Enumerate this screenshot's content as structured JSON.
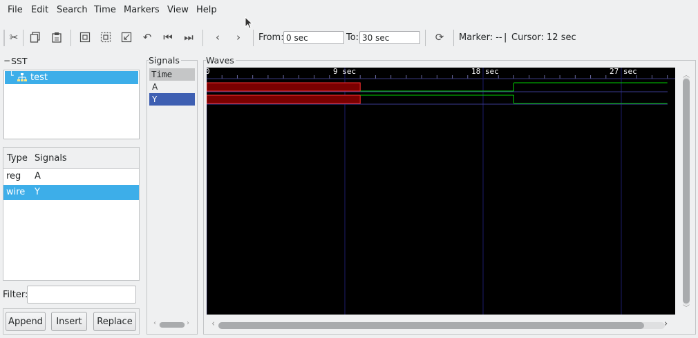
{
  "menu": [
    "File",
    "Edit",
    "Search",
    "Time",
    "Markers",
    "View",
    "Help"
  ],
  "toolbar": {
    "from_label": "From:",
    "from_value": "0 sec",
    "to_label": "To:",
    "to_value": "30 sec",
    "marker_text": "Marker: --",
    "separator": "|",
    "cursor_text": "Cursor: 12 sec"
  },
  "sst": {
    "title": "SST",
    "tree_item": "test",
    "table_headers": [
      "Type",
      "Signals"
    ],
    "rows": [
      {
        "type": "reg",
        "signal": "A"
      },
      {
        "type": "wire",
        "signal": "Y"
      }
    ],
    "filter_label": "Filter:",
    "filter_value": "",
    "buttons": [
      "Append",
      "Insert",
      "Replace"
    ]
  },
  "signals_panel": {
    "title": "Signals",
    "header": "Time",
    "items": [
      "A",
      "Y"
    ]
  },
  "waves_panel": {
    "title": "Waves",
    "time_labels": [
      "0",
      "9 sec",
      "18 sec",
      "27 sec"
    ],
    "time_range": [
      0,
      30
    ],
    "signals": [
      {
        "name": "A",
        "segments": [
          {
            "start": 0,
            "end": 10,
            "value": "x"
          },
          {
            "start": 10,
            "end": 20,
            "value": 0
          },
          {
            "start": 20,
            "end": 30,
            "value": 1
          }
        ]
      },
      {
        "name": "Y",
        "segments": [
          {
            "start": 0,
            "end": 10,
            "value": "x"
          },
          {
            "start": 10,
            "end": 20,
            "value": 1
          },
          {
            "start": 20,
            "end": 30,
            "value": 0
          }
        ]
      }
    ],
    "colors": {
      "background": "#000000",
      "wave": "#00d000",
      "undefined_fill": "#7a0000",
      "undefined_border": "#ff3030",
      "grid": "#1c1c6a",
      "text": "#ffffff"
    }
  }
}
